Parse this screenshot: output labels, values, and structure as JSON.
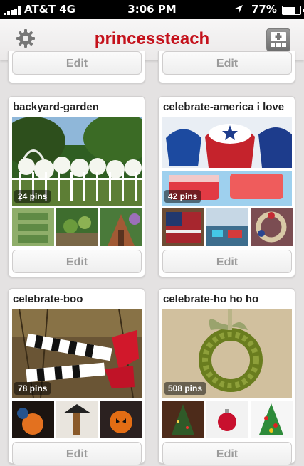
{
  "status_bar": {
    "carrier": "AT&T  4G",
    "time": "3:06 PM",
    "battery": "77%"
  },
  "header": {
    "title": "princessteach",
    "settings_icon": "gear-icon",
    "add_icon": "add-board-icon"
  },
  "edit_label": "Edit",
  "boards": [
    {
      "name": "backyard-garden",
      "pins": "24 pins"
    },
    {
      "name": "celebrate-america i love",
      "pins": "42 pins"
    },
    {
      "name": "celebrate-boo",
      "pins": "78 pins"
    },
    {
      "name": "celebrate-ho ho ho",
      "pins": "508 pins"
    }
  ],
  "colors": {
    "brand": "#c4111b",
    "background": "#e4e2e2"
  }
}
